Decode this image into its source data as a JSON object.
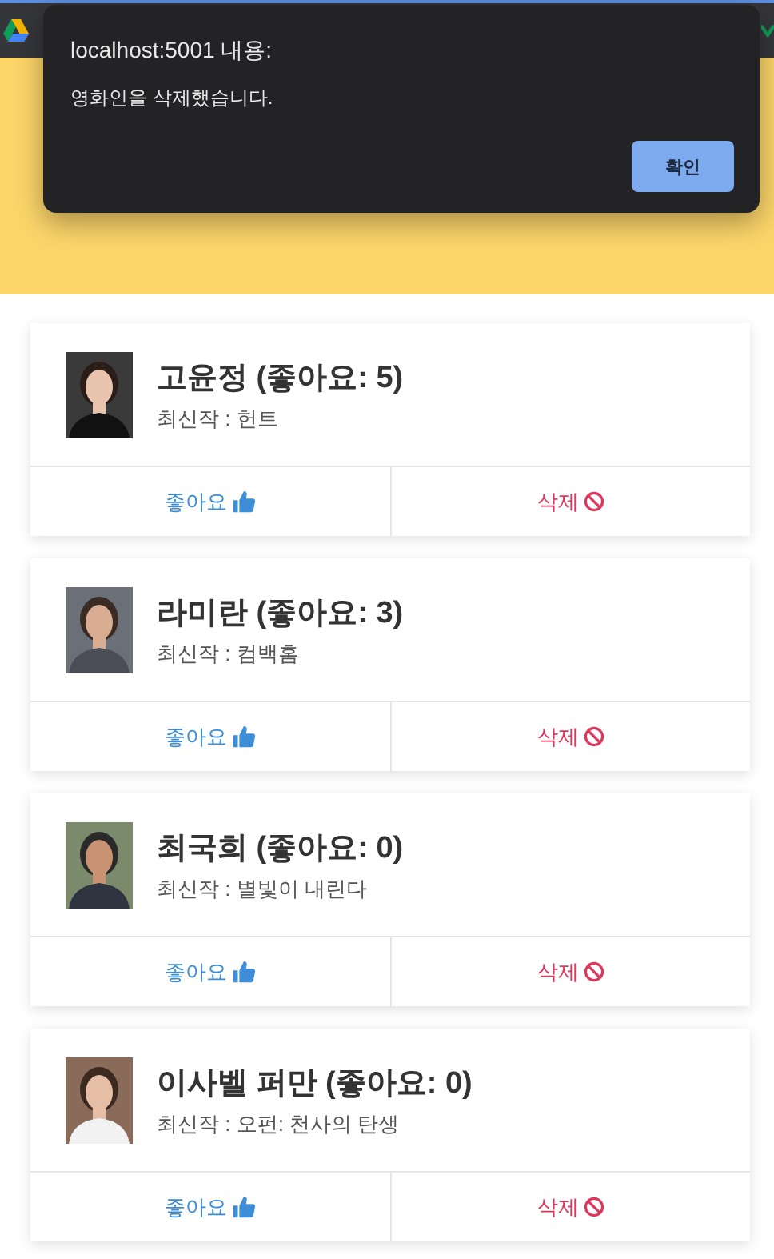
{
  "dialog": {
    "title": "localhost:5001 내용:",
    "message": "영화인을 삭제했습니다.",
    "button": "확인"
  },
  "people": [
    {
      "title": "고윤정 (좋아요: 5)",
      "latest": "최신작 : 헌트",
      "like": "좋아요",
      "delete": "삭제"
    },
    {
      "title": "라미란 (좋아요: 3)",
      "latest": "최신작 : 컴백홈",
      "like": "좋아요",
      "delete": "삭제"
    },
    {
      "title": "최국희 (좋아요: 0)",
      "latest": "최신작 : 별빛이 내린다",
      "like": "좋아요",
      "delete": "삭제"
    },
    {
      "title": "이사벨 퍼만 (좋아요: 0)",
      "latest": "최신작 : 오펀: 천사의 탄생",
      "like": "좋아요",
      "delete": "삭제"
    }
  ]
}
